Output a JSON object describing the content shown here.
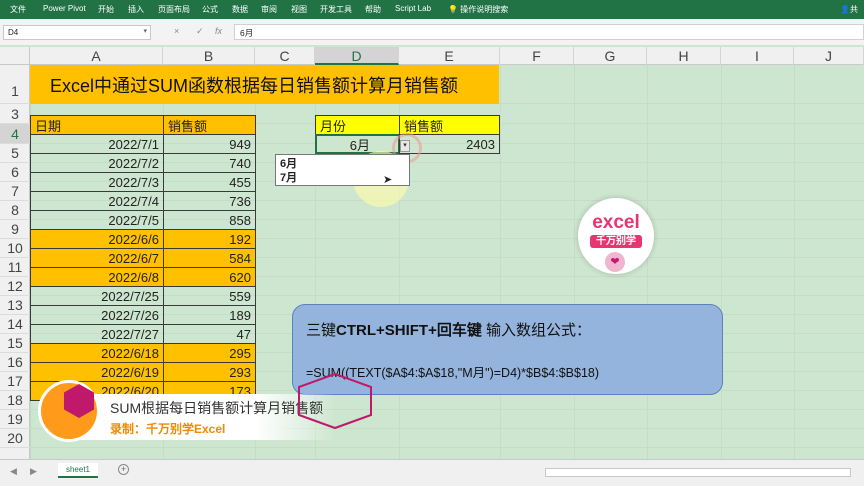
{
  "menu": [
    "文件",
    "Power Pivot",
    "开始",
    "插入",
    "页面布局",
    "公式",
    "数据",
    "审阅",
    "视图",
    "开发工具",
    "帮助",
    "Script Lab"
  ],
  "tell_me": "操作说明搜索",
  "share": "共",
  "formula_bar": {
    "name_box": "D4",
    "formula": "6月",
    "cancel": "×",
    "confirm": "✓",
    "fx": "fx"
  },
  "columns": [
    "A",
    "B",
    "C",
    "D",
    "E",
    "F",
    "G",
    "H",
    "I",
    "J"
  ],
  "selected_column": "D",
  "rows": [
    "1",
    "3",
    "4",
    "5",
    "6",
    "7",
    "8",
    "9",
    "10",
    "11",
    "12",
    "13",
    "14",
    "15",
    "16",
    "17",
    "18",
    "19",
    "20"
  ],
  "selected_row": "4",
  "title": "Excel中通过SUM函数根据每日销售额计算月销售额",
  "table": {
    "header_date": "日期",
    "header_sales": "销售额",
    "rows": [
      {
        "date": "2022/7/1",
        "sales": "949",
        "hl": false
      },
      {
        "date": "2022/7/2",
        "sales": "740",
        "hl": false
      },
      {
        "date": "2022/7/3",
        "sales": "455",
        "hl": false
      },
      {
        "date": "2022/7/4",
        "sales": "736",
        "hl": false
      },
      {
        "date": "2022/7/5",
        "sales": "858",
        "hl": false
      },
      {
        "date": "2022/6/6",
        "sales": "192",
        "hl": true
      },
      {
        "date": "2022/6/7",
        "sales": "584",
        "hl": true
      },
      {
        "date": "2022/6/8",
        "sales": "620",
        "hl": true
      },
      {
        "date": "2022/7/25",
        "sales": "559",
        "hl": false
      },
      {
        "date": "2022/7/26",
        "sales": "189",
        "hl": false
      },
      {
        "date": "2022/7/27",
        "sales": "47",
        "hl": false
      },
      {
        "date": "2022/6/18",
        "sales": "295",
        "hl": true
      },
      {
        "date": "2022/6/19",
        "sales": "293",
        "hl": true
      },
      {
        "date": "2022/6/20",
        "sales": "173",
        "hl": true
      }
    ]
  },
  "summary": {
    "header_month": "月份",
    "header_sales": "销售额",
    "month": "6月",
    "sales": "2403"
  },
  "dropdown_options": [
    "6月",
    "7月"
  ],
  "logo": {
    "line1": "excel",
    "line2": "千万别学"
  },
  "info": {
    "line1_prefix": "三键",
    "line1_bold": "CTRL+SHIFT+回车键",
    "line1_suffix": " 输入数组公式：",
    "line2": "=SUM((TEXT($A$4:$A$18,\"M月\")=D4)*$B$4:$B$18)"
  },
  "banner": {
    "title": "SUM根据每日销售额计算月销售额",
    "subtitle": "录制：千万别学Excel"
  },
  "sheet_tab": "sheet1",
  "colors": {
    "ribbon": "#217346",
    "orange": "#ffc000",
    "yellow": "#ffff00",
    "sheet_bg": "#cde6cf",
    "info_bg": "#95b4dd"
  }
}
